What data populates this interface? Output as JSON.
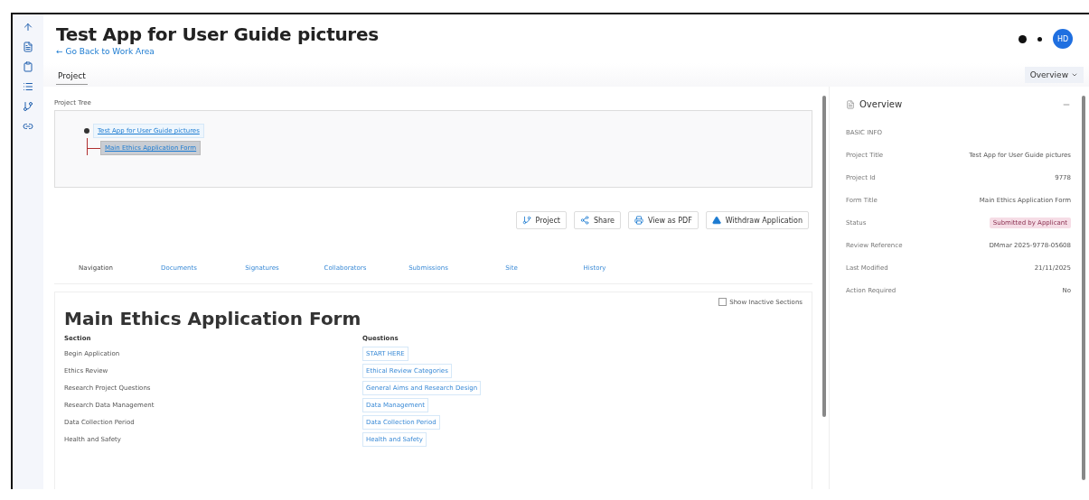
{
  "header": {
    "title": "Test App for User Guide pictures",
    "back_link": "← Go Back to Work Area",
    "avatar": "HD"
  },
  "top_tabs": [
    {
      "label": "Project",
      "selected": true
    }
  ],
  "panel_toggle": {
    "label": "Overview"
  },
  "project_tree": {
    "label": "Project Tree",
    "root": {
      "label": "Test App for User Guide pictures",
      "selected": false,
      "children": [
        {
          "label": "Main Ethics Application Form",
          "selected": true
        }
      ]
    }
  },
  "actions": [
    {
      "label": "Project",
      "kind": "tree"
    },
    {
      "label": "Share",
      "kind": "share"
    },
    {
      "label": "View as PDF",
      "kind": "pdf"
    },
    {
      "label": "Withdraw Application",
      "kind": "warning"
    }
  ],
  "form_tabs": [
    {
      "label": "Navigation",
      "selected": true
    },
    {
      "label": "Documents",
      "selected": false
    },
    {
      "label": "Signatures",
      "selected": false
    },
    {
      "label": "Collaborators",
      "selected": false
    },
    {
      "label": "Submissions",
      "selected": false
    },
    {
      "label": "Site",
      "selected": false
    },
    {
      "label": "History",
      "selected": false
    }
  ],
  "form": {
    "title": "Main Ethics Application Form",
    "show_inactive": {
      "label": "Show Inactive Sections",
      "checked": false
    },
    "columns": [
      "Section",
      "Questions"
    ],
    "rows": [
      {
        "section": "Begin Application",
        "question": "START HERE"
      },
      {
        "section": "Ethics Review",
        "question": "Ethical Review Categories"
      },
      {
        "section": "Research Project Questions",
        "question": "General Aims and Research Design"
      },
      {
        "section": "Research Data Management",
        "question": "Data Management"
      },
      {
        "section": "Data Collection Period",
        "question": "Data Collection Period"
      },
      {
        "section": "Health and Safety",
        "question": "Health and Safety"
      }
    ]
  },
  "overview": {
    "title": "Overview",
    "group": "BASIC INFO",
    "fields": [
      {
        "label": "Project Title",
        "value": "Test App for User Guide pictures",
        "kind": "text"
      },
      {
        "label": "Project Id",
        "value": "9778",
        "kind": "text"
      },
      {
        "label": "Form Title",
        "value": "Main Ethics Application Form",
        "kind": "text"
      },
      {
        "label": "Status",
        "value": "Submitted by Applicant",
        "kind": "badge"
      },
      {
        "label": "Review Reference",
        "value": "DMmar 2025-9778-05608",
        "kind": "text"
      },
      {
        "label": "Last Modified",
        "value": "21/11/2025",
        "kind": "text"
      },
      {
        "label": "Action Required",
        "value": "No",
        "kind": "text"
      }
    ]
  }
}
